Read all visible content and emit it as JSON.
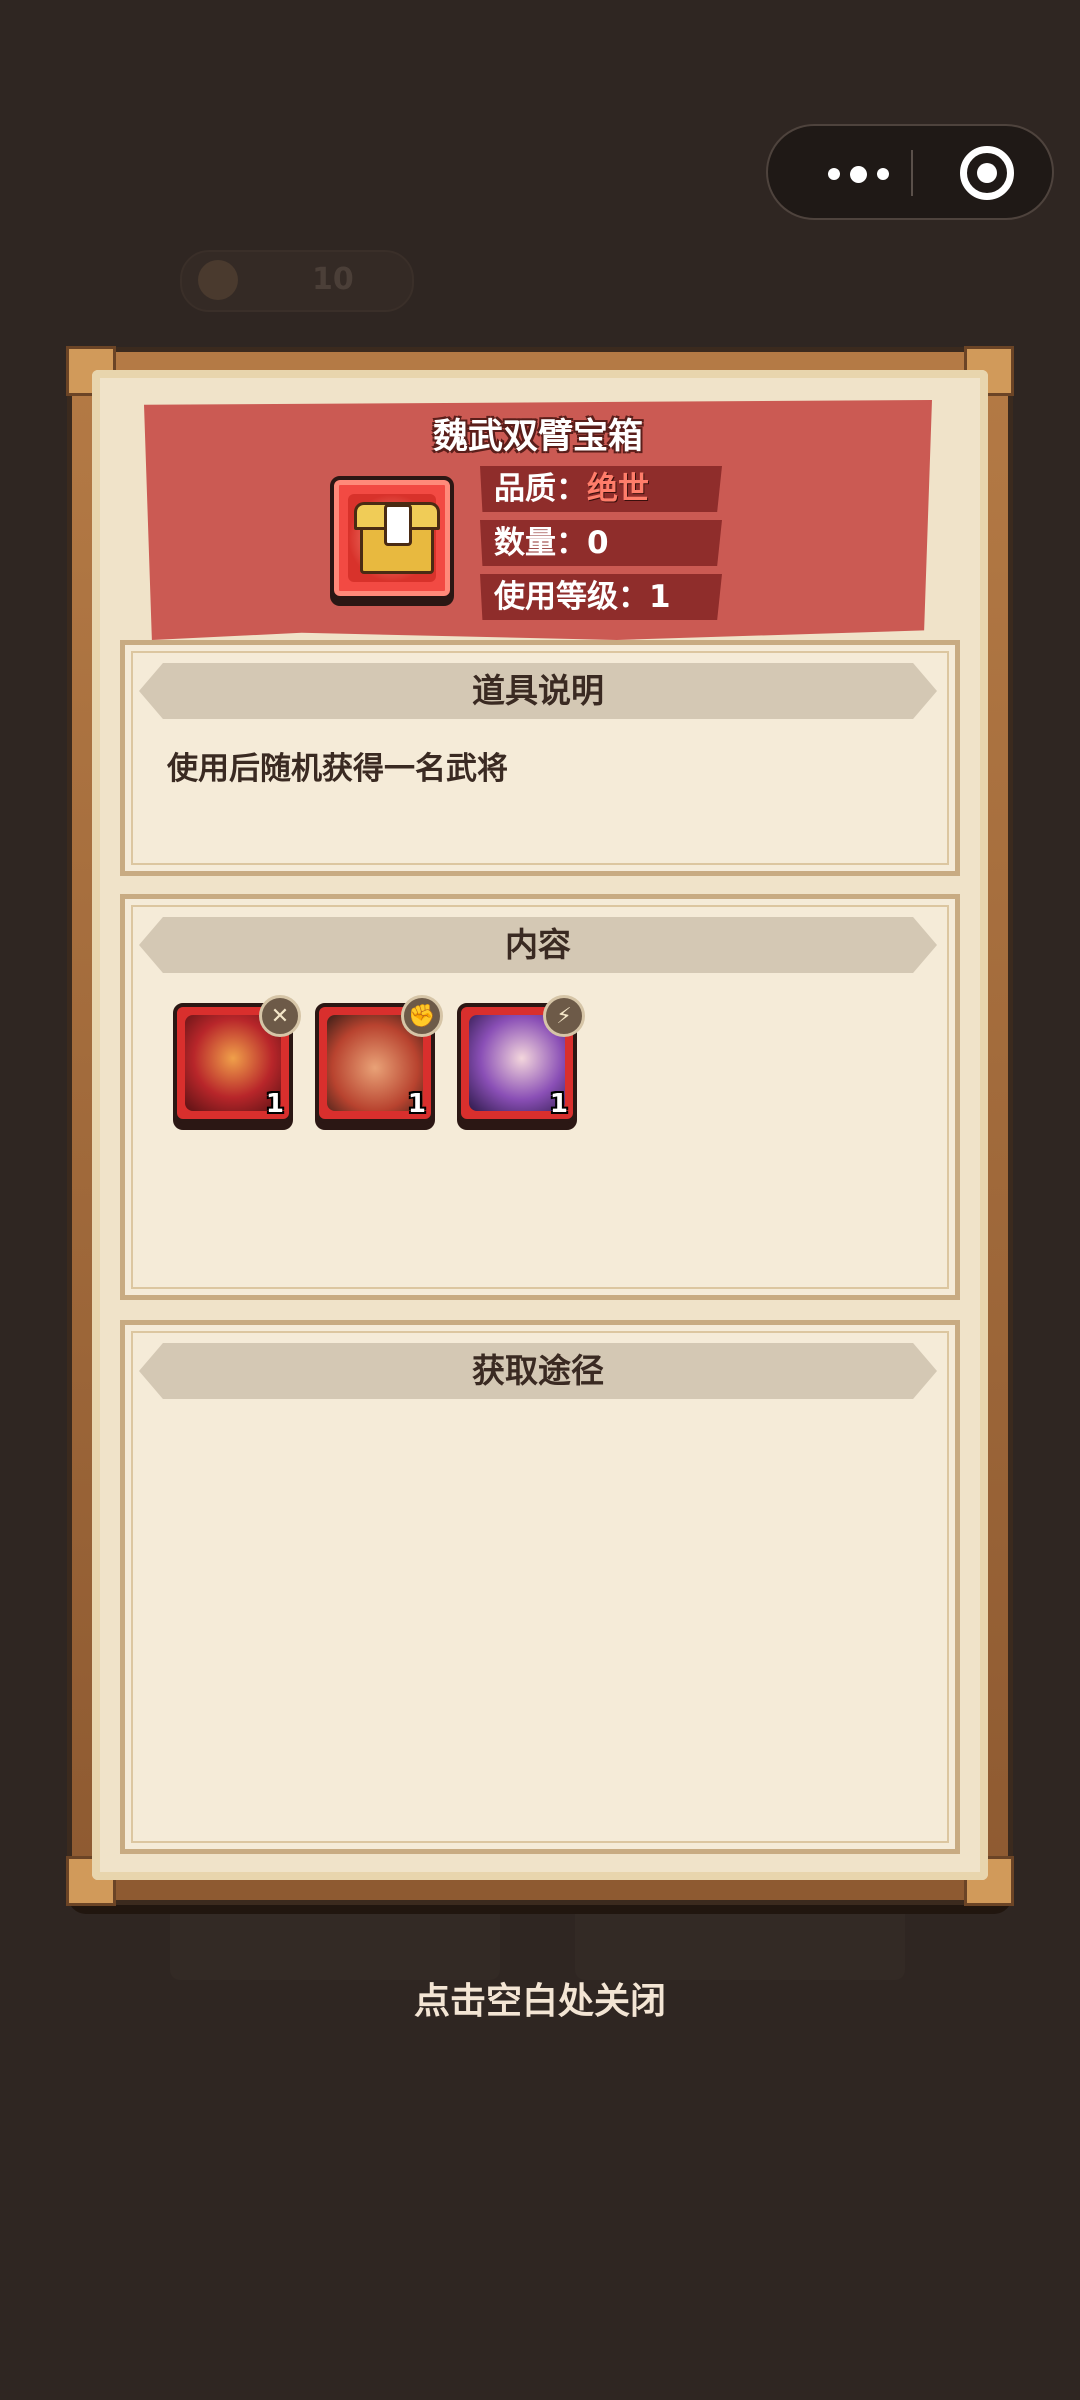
{
  "background": {
    "currency_value": "10"
  },
  "capsule": {
    "menu_icon": "more-dots-icon",
    "close_icon": "target-icon"
  },
  "item": {
    "title": "魏武双臂宝箱",
    "quality_label": "品质：",
    "quality_value": "绝世",
    "quality_color": "#ff7d6a",
    "quantity_label": "数量：",
    "quantity_value": "0",
    "level_label": "使用等级：",
    "level_value": "1"
  },
  "sections": {
    "description": {
      "header": "道具说明",
      "text": "使用后随机获得一名武将"
    },
    "contents": {
      "header": "内容",
      "heroes": [
        {
          "count": "1",
          "element_icon": "crossed-arrows-icon"
        },
        {
          "count": "1",
          "element_icon": "fist-icon"
        },
        {
          "count": "1",
          "element_icon": "lightning-icon"
        }
      ]
    },
    "obtain": {
      "header": "获取途径"
    }
  },
  "close_hint": "点击空白处关闭",
  "colors": {
    "banner": "#cb5a53",
    "paper": "#f0e3c9",
    "background": "#2f2622"
  }
}
